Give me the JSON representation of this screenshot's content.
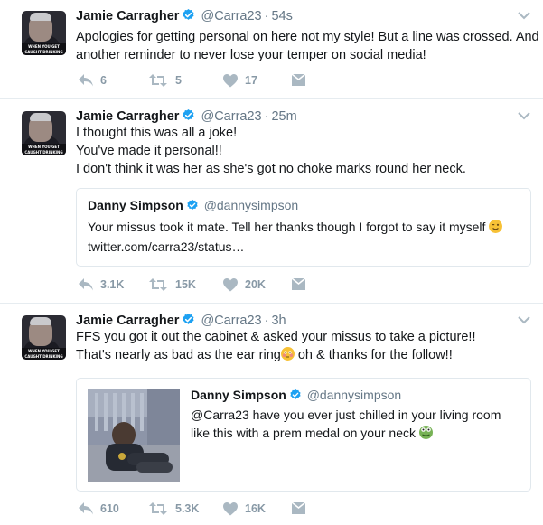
{
  "colors": {
    "text": "#14171a",
    "meta": "#657786",
    "action": "#8899a6",
    "verified": "#1da1f2",
    "divider": "#e6ecf0",
    "link": "#14171a"
  },
  "tweets": [
    {
      "name": "Jamie Carragher",
      "handle": "@Carra23",
      "time": "54s",
      "avatar_caption": "WHEN YOU GET CAUGHT DRINKING ON THE TRAIN",
      "lines": [
        "Apologies for getting personal on here not my style! But a line was crossed. And",
        "another reminder to never lose your temper on social media!"
      ],
      "reply_count": "6",
      "retweet_count": "5",
      "like_count": "17"
    },
    {
      "name": "Jamie Carragher",
      "handle": "@Carra23",
      "time": "25m",
      "avatar_caption": "WHEN YOU GET CAUGHT DRINKING ON THE TRAIN",
      "lines": [
        "I thought this was all a joke!",
        "You've made it personal!!",
        "I don't think it was her as she's got no choke marks round her neck."
      ],
      "quote": {
        "name": "Danny Simpson",
        "handle": "@dannysimpson",
        "text": "Your missus took it mate. Tell her thanks though I forgot to say it myself",
        "text_emoji": "winking-face-emoji",
        "link": "twitter.com/carra23/status…"
      },
      "reply_count": "3.1K",
      "retweet_count": "15K",
      "like_count": "20K"
    },
    {
      "name": "Jamie Carragher",
      "handle": "@Carra23",
      "time": "3h",
      "avatar_caption": "WHEN YOU GET CAUGHT DRINKING ON THE TRAIN",
      "line1": "FFS you got it out the cabinet & asked your missus to take a picture!!",
      "line2_before": "That's nearly as bad as the ear ring",
      "line2_emoji": "flushed-face-emoji",
      "line2_after": " oh & thanks for the follow!!",
      "quote": {
        "name": "Danny Simpson",
        "handle": "@dannysimpson",
        "line1": "@Carra23 have you ever just chilled in your living room",
        "line2": "like this with a prem medal on your neck",
        "line2_emoji": "frog-face-emoji"
      },
      "reply_count": "610",
      "retweet_count": "5.3K",
      "like_count": "16K"
    }
  ]
}
